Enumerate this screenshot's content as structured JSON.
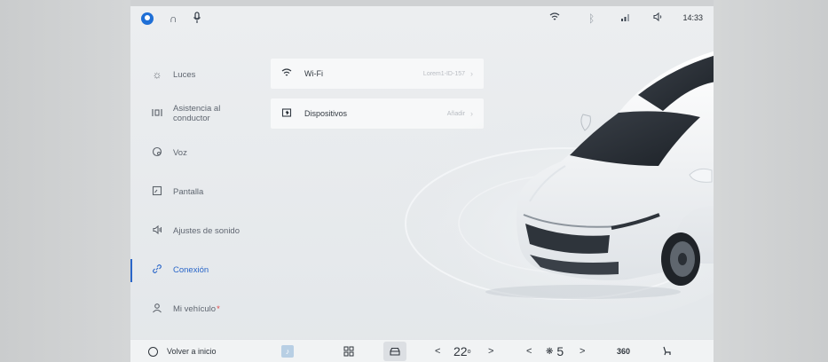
{
  "status_bar": {
    "left_icons": [
      "user-avatar-icon",
      "headset-icon",
      "microphone-icon"
    ],
    "right_icons": [
      "wifi-icon",
      "bluetooth-icon",
      "signal-icon",
      "volume-icon"
    ],
    "time": "14:33"
  },
  "menu": {
    "items": [
      {
        "label": "Luces",
        "icon": "sun-icon"
      },
      {
        "label": "Asistencia al conductor",
        "icon": "driver-assist-icon"
      },
      {
        "label": "Voz",
        "icon": "voice-icon"
      },
      {
        "label": "Pantalla",
        "icon": "display-icon"
      },
      {
        "label": "Ajustes de sonido",
        "icon": "speaker-icon"
      },
      {
        "label": "Conexión",
        "icon": "link-icon",
        "active": true
      },
      {
        "label": "Mi vehículo",
        "icon": "person-icon",
        "badge": "*"
      }
    ]
  },
  "cards": {
    "wifi": {
      "title": "Wi-Fi",
      "value": "Lorem1-ID-157"
    },
    "devices": {
      "title": "Dispositivos",
      "value": "Añadir"
    }
  },
  "dock": {
    "home_label": "Volver a inicio",
    "temperature": "22",
    "temperature_unit": "o",
    "fan_level": "5",
    "camera_label": "360",
    "prev": "<",
    "next": ">"
  },
  "colors": {
    "accent": "#2a66c9",
    "background": "#e8ebee",
    "card": "#f7f8f9"
  }
}
